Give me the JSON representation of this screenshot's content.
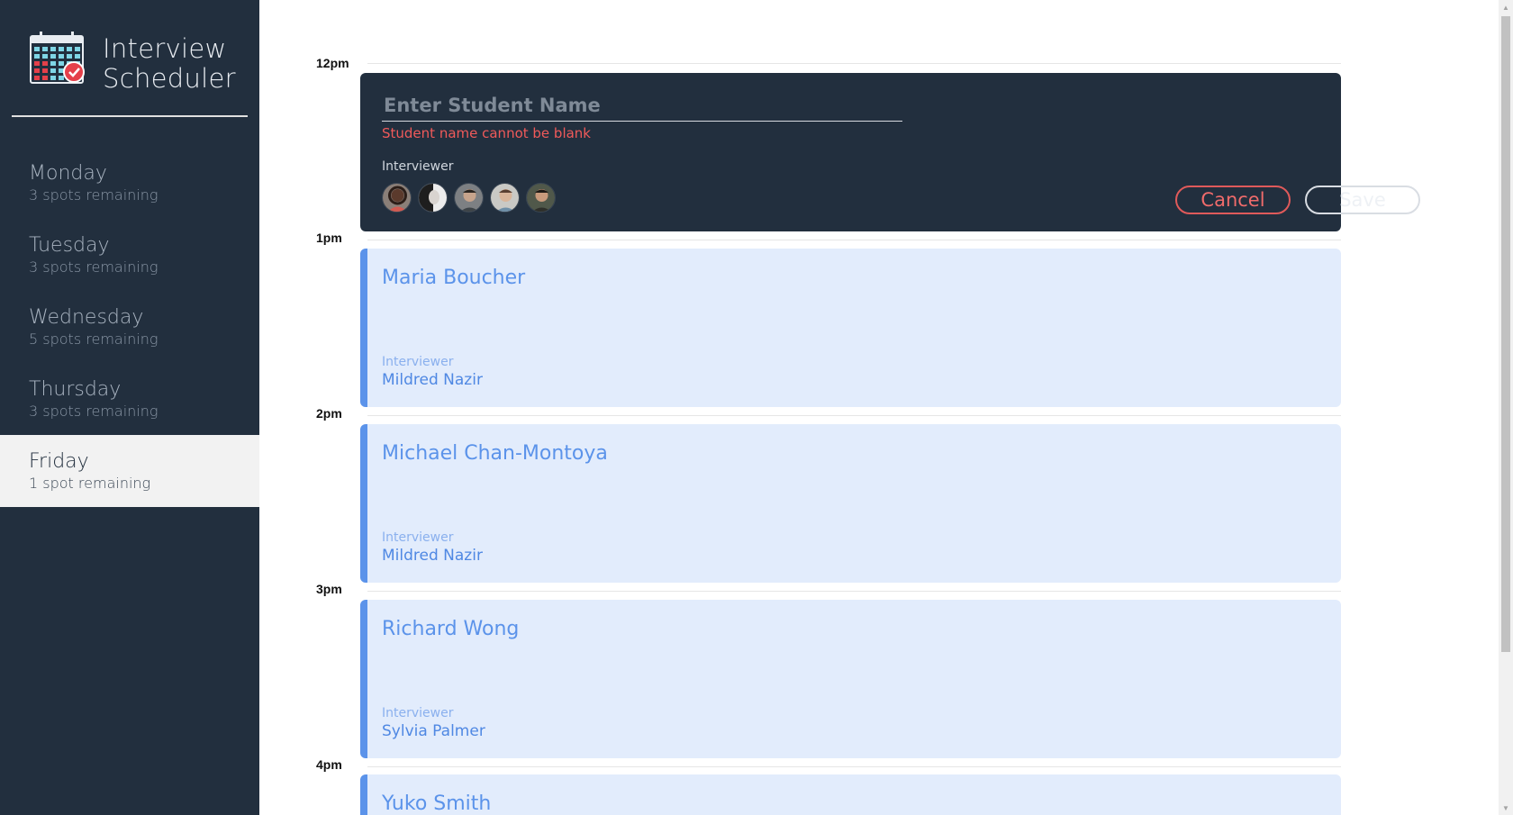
{
  "app": {
    "title_line1": "Interview",
    "title_line2": "Scheduler"
  },
  "days": [
    {
      "name": "Monday",
      "spots": "3 spots remaining",
      "selected": false
    },
    {
      "name": "Tuesday",
      "spots": "3 spots remaining",
      "selected": false
    },
    {
      "name": "Wednesday",
      "spots": "5 spots remaining",
      "selected": false
    },
    {
      "name": "Thursday",
      "spots": "3 spots remaining",
      "selected": false
    },
    {
      "name": "Friday",
      "spots": "1 spot remaining",
      "selected": true
    }
  ],
  "hours": [
    "12pm",
    "1pm",
    "2pm",
    "3pm",
    "4pm"
  ],
  "form": {
    "student_placeholder": "Enter Student Name",
    "student_value": "",
    "error": "Student name cannot be blank",
    "interviewer_label": "Interviewer",
    "interviewers": [
      {
        "icon": "interviewer-avatar-1"
      },
      {
        "icon": "interviewer-avatar-2"
      },
      {
        "icon": "interviewer-avatar-3"
      },
      {
        "icon": "interviewer-avatar-4"
      },
      {
        "icon": "interviewer-avatar-5"
      }
    ],
    "cancel_label": "Cancel",
    "save_label": "Save"
  },
  "appointments": [
    {
      "student": "Maria Boucher",
      "interviewer_label": "Interviewer",
      "interviewer": "Mildred Nazir"
    },
    {
      "student": "Michael Chan-Montoya",
      "interviewer_label": "Interviewer",
      "interviewer": "Mildred Nazir"
    },
    {
      "student": "Richard Wong",
      "interviewer_label": "Interviewer",
      "interviewer": "Sylvia Palmer"
    },
    {
      "student": "Yuko Smith",
      "interviewer_label": "",
      "interviewer": ""
    }
  ],
  "colors": {
    "sidebar": "#222f3e",
    "accent_blue": "#5b93ea",
    "card_blue": "#e2ecfc",
    "error_red": "#f05a5a"
  }
}
